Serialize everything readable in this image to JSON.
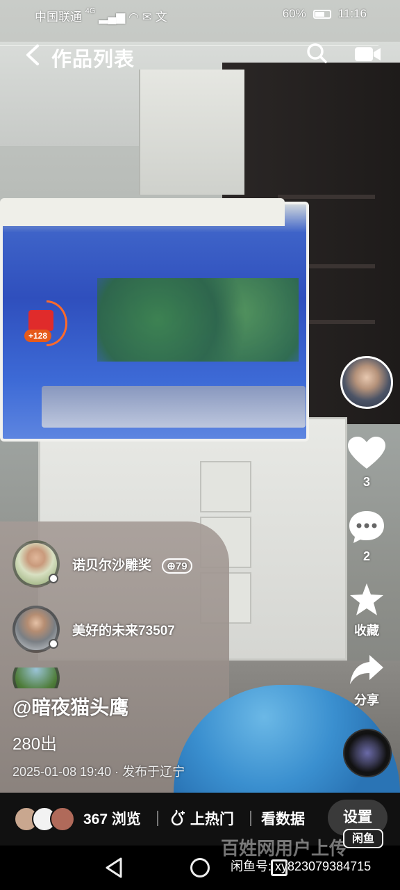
{
  "status_bar": {
    "carrier": "中国联通",
    "network": "4G",
    "battery": "60%",
    "time": "11:16"
  },
  "header": {
    "back_icon": "chevron-left-icon",
    "title": "作品列表",
    "search_icon": "search-icon",
    "video_icon": "video-camera-icon"
  },
  "red_packet": {
    "icon": "red-envelope-icon",
    "badge": "+128"
  },
  "right_rail": {
    "like_count": "3",
    "comment_count": "2",
    "favorite_label": "收藏",
    "share_label": "分享"
  },
  "comments": [
    {
      "name": "诺贝尔沙雕奖",
      "badge": "79"
    },
    {
      "name": "美好的未来73507"
    }
  ],
  "post": {
    "author": "@暗夜猫头鹰",
    "description": "280出",
    "meta": "2025-01-08 19:40 · 发布于辽宁"
  },
  "bottom_bar": {
    "views": "367 浏览",
    "boost_label": "上热门",
    "stats_label": "看数据",
    "settings_label": "设置"
  },
  "watermark": {
    "logo": "闲鱼",
    "text": "百姓网用户上传",
    "id": "闲鱼号: xy823079384715"
  },
  "colors": {
    "accent_orange": "#ff6a2a",
    "red_packet": "#e02b2b",
    "bar_bg": "#111111"
  }
}
